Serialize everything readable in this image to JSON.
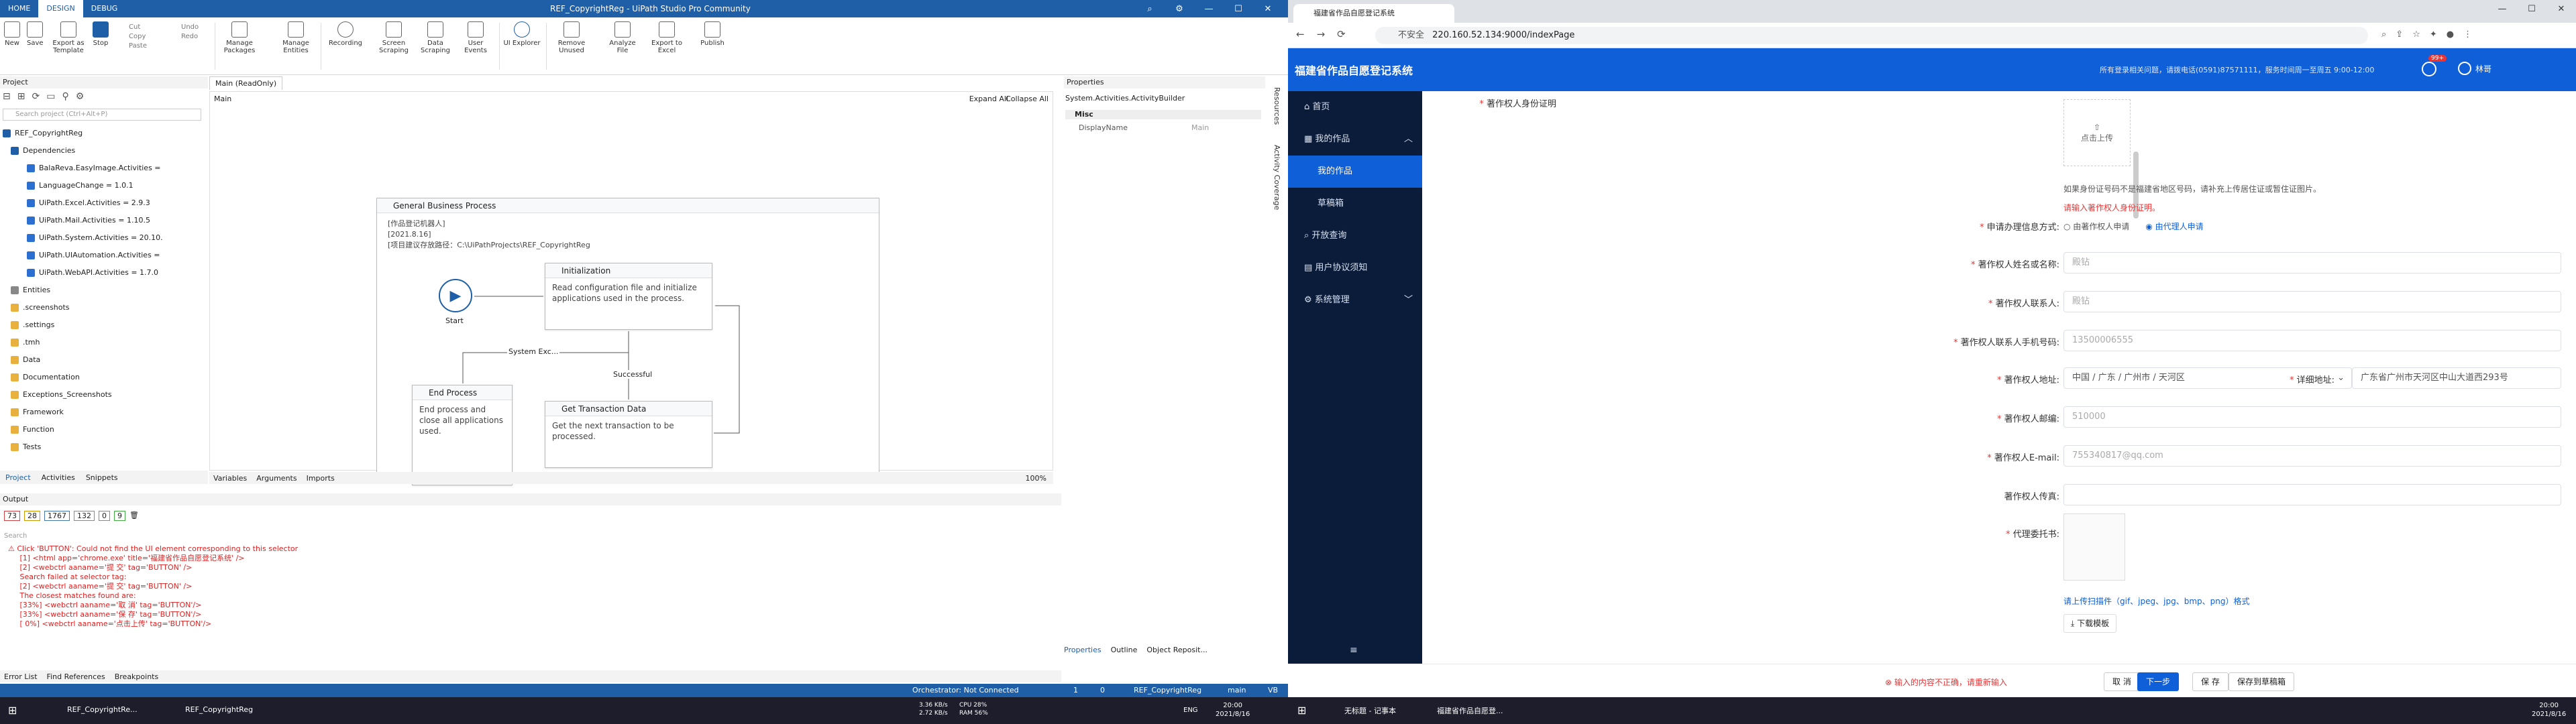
{
  "studio": {
    "ribbon_tabs": [
      "HOME",
      "DESIGN",
      "DEBUG"
    ],
    "window_title": "REF_CopyrightReg - UiPath Studio Pro Community",
    "ribbon_buttons": [
      {
        "label": "New",
        "icon": "new-icon"
      },
      {
        "label": "Save",
        "icon": "save-icon"
      },
      {
        "label": "Export as Template",
        "icon": "export-template-icon"
      },
      {
        "label": "Stop",
        "icon": "stop-icon"
      }
    ],
    "clipboard": [
      "Cut",
      "Copy",
      "Paste"
    ],
    "undo_redo": [
      "Undo",
      "Redo"
    ],
    "ribbon_buttons2": [
      {
        "label": "Manage Packages"
      },
      {
        "label": "Manage Entities"
      },
      {
        "label": "Recording"
      },
      {
        "label": "Screen Scraping"
      },
      {
        "label": "Data Scraping"
      },
      {
        "label": "User Events"
      },
      {
        "label": "UI Explorer"
      },
      {
        "label": "Remove Unused"
      },
      {
        "label": "Analyze File"
      },
      {
        "label": "Export to Excel"
      },
      {
        "label": "Publish"
      }
    ],
    "project_header": "Project",
    "search_placeholder": "Search project (Ctrl+Alt+P)",
    "tree": [
      "REF_CopyrightReg",
      "Dependencies",
      "BalaReva.EasyImage.Activities =",
      "LanguageChange = 1.0.1",
      "UiPath.Excel.Activities = 2.9.3",
      "UiPath.Mail.Activities = 1.10.5",
      "UiPath.System.Activities = 20.10.",
      "UiPath.UIAutomation.Activities =",
      "UiPath.WebAPI.Activities = 1.7.0",
      "Entities",
      ".screenshots",
      ".settings",
      ".tmh",
      "Data",
      "Documentation",
      "Exceptions_Screenshots",
      "Framework",
      "Function",
      "Tests"
    ],
    "panel_tabs": [
      "Project",
      "Activities",
      "Snippets"
    ],
    "doc_tab": "Main (ReadOnly)",
    "breadcrumb": "Main",
    "expand_all": "Expand All",
    "collapse_all": "Collapse All",
    "sequence_title": "General Business Process",
    "annotation": [
      "[作品登记机器人]",
      "[2021.8.16]",
      "[项目建议存放路径：C:\\UiPathProjects\\REF_CopyrightReg"
    ],
    "start_label": "Start",
    "init": {
      "title": "Initialization",
      "body": "Read configuration file and initialize applications used in the process."
    },
    "end": {
      "title": "End Process",
      "body": "End process and close all applications used."
    },
    "get": {
      "title": "Get Transaction Data",
      "body": "Get the next transaction to be processed."
    },
    "system_exc": "System Exc...",
    "successful": "Successful",
    "designer_tabs": [
      "Variables",
      "Arguments",
      "Imports"
    ],
    "zoom": "100%",
    "properties": {
      "title": "Properties",
      "subtitle": "System.Activities.ActivityBuilder",
      "section": "Misc",
      "row_key": "DisplayName",
      "row_val": "Main"
    },
    "side_tabs": [
      "Resources",
      "Activity Coverage"
    ],
    "props_tabs": [
      "Properties",
      "Outline",
      "Object Reposit..."
    ],
    "output": {
      "header": "Output",
      "counts": [
        "73",
        "28",
        "1767",
        "132",
        "0",
        "9"
      ],
      "search": "Search",
      "lines": [
        "⚠ Click 'BUTTON': Could not find the UI element corresponding to this selector",
        "     [1] <html app='chrome.exe' title='福建省作品自愿登记系统' />",
        "     [2] <webctrl aaname='提 交' tag='BUTTON' />",
        "",
        "     Search failed at selector tag:",
        "     [2] <webctrl aaname='提 交' tag='BUTTON' />",
        "",
        "     The closest matches found are:",
        "     [33%] <webctrl aaname='取 消' tag='BUTTON'/>",
        "     [33%] <webctrl aaname='保 存' tag='BUTTON'/>",
        "     [ 0%] <webctrl aaname='点击上传' tag='BUTTON'/>"
      ]
    },
    "bottom_tabs": [
      "Error List",
      "Find References",
      "Breakpoints"
    ],
    "status": {
      "orchestrator": "Orchestrator: Not Connected",
      "errs": "1",
      "warn": "0",
      "project": "REF_CopyrightReg",
      "branch": "main",
      "vb": "VB"
    }
  },
  "browser": {
    "tab_title": "福建省作品自愿登记系统",
    "url": "220.160.52.134:9000/indexPage",
    "not_secure": "不安全",
    "app_title": "福建省作品自愿登记系统",
    "notice": "所有登录相关问题，请拨电话(0591)87571111，服务时间周一至周五 9:00-12:00",
    "badge": "99+",
    "user": "林哥",
    "nav": [
      {
        "label": "首页",
        "icon": "home-icon"
      },
      {
        "label": "我的作品",
        "icon": "works-icon"
      },
      {
        "label": "我的作品",
        "icon": ""
      },
      {
        "label": "草稿箱",
        "icon": ""
      },
      {
        "label": "开放查询",
        "icon": "search-icon"
      },
      {
        "label": "用户协议须知",
        "icon": "doc-icon"
      },
      {
        "label": "系统管理",
        "icon": "gear-icon"
      }
    ],
    "form": {
      "id_label": "著作权人身份证明",
      "upload": "点击上传",
      "id_hint": "如果身份证号码不是福建省地区号码，请补充上传居住证或暂住证图片。",
      "id_error": "请输入著作权人身份证明。",
      "method_label": "申请办理信息方式:",
      "method_opts": [
        "由著作权人申请",
        "由代理人申请"
      ],
      "name_label": "著作权人姓名或名称:",
      "name_val": "殿钻",
      "contact_label": "著作权人联系人:",
      "contact_val": "殿钻",
      "phone_label": "著作权人联系人手机号码:",
      "phone_val": "13500006555",
      "addr_label": "著作权人地址:",
      "addr_val": "中国 / 广东 / 广州市 / 天河区",
      "detail_label": "详细地址:",
      "detail_val": "广东省广州市天河区中山大道西293号",
      "zip_label": "著作权人邮编:",
      "zip_val": "510000",
      "email_label": "著作权人E-mail:",
      "email_val": "755340817@qq.com",
      "fax_label": "著作权人传真:",
      "proxy_label": "代理委托书:",
      "proxy_hint": "请上传扫描件（gif、jpeg、jpg、bmp、png）格式",
      "download": "下载模板"
    },
    "footer": {
      "error": "输入的内容不正确，请重新输入",
      "buttons": [
        "取 消",
        "下一步",
        "保 存",
        "保存到草稿箱"
      ]
    }
  },
  "taskbar": {
    "left_items": [
      "REF_CopyrightRe...",
      "REF_CopyrightReg"
    ],
    "net": [
      "3.36 KB/s",
      "2.72 KB/s"
    ],
    "cpu": "CPU 28%",
    "ram": "RAM 56%",
    "time1": "20:00",
    "date1": "2021/8/16",
    "lang": "ENG",
    "right_items": [
      "无标题 - 记事本",
      "福建省作品自愿登..."
    ],
    "time2": "20:00",
    "date2": "2021/8/16"
  }
}
